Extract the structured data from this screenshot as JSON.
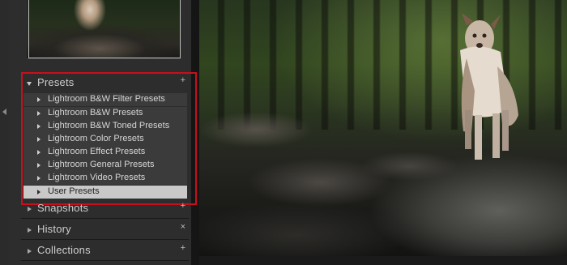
{
  "sidebar": {
    "presets_panel": {
      "title": "Presets",
      "add_symbol": "+",
      "items": [
        {
          "label": "Lightroom B&W Filter Presets"
        },
        {
          "label": "Lightroom B&W Presets"
        },
        {
          "label": "Lightroom B&W Toned Presets"
        },
        {
          "label": "Lightroom Color Presets"
        },
        {
          "label": "Lightroom Effect Presets"
        },
        {
          "label": "Lightroom General Presets"
        },
        {
          "label": "Lightroom Video Presets"
        },
        {
          "label": "User Presets",
          "selected": true
        }
      ]
    },
    "snapshots_panel": {
      "title": "Snapshots",
      "add_symbol": "+"
    },
    "history_panel": {
      "title": "History",
      "clear_symbol": "×"
    },
    "collections_panel": {
      "title": "Collections",
      "add_symbol": "+"
    }
  },
  "colors": {
    "panel_bg": "#2d2d2d",
    "row_bg": "#3b3b3b",
    "selected_row_bg": "#c9c9c9",
    "highlight_outline": "#c8101c"
  },
  "icons": {
    "panel_collapse_left": "triangle-left-icon",
    "panel_expanded": "triangle-down-icon",
    "panel_collapsed": "triangle-right-icon",
    "preset_folder": "triangle-right-icon"
  }
}
